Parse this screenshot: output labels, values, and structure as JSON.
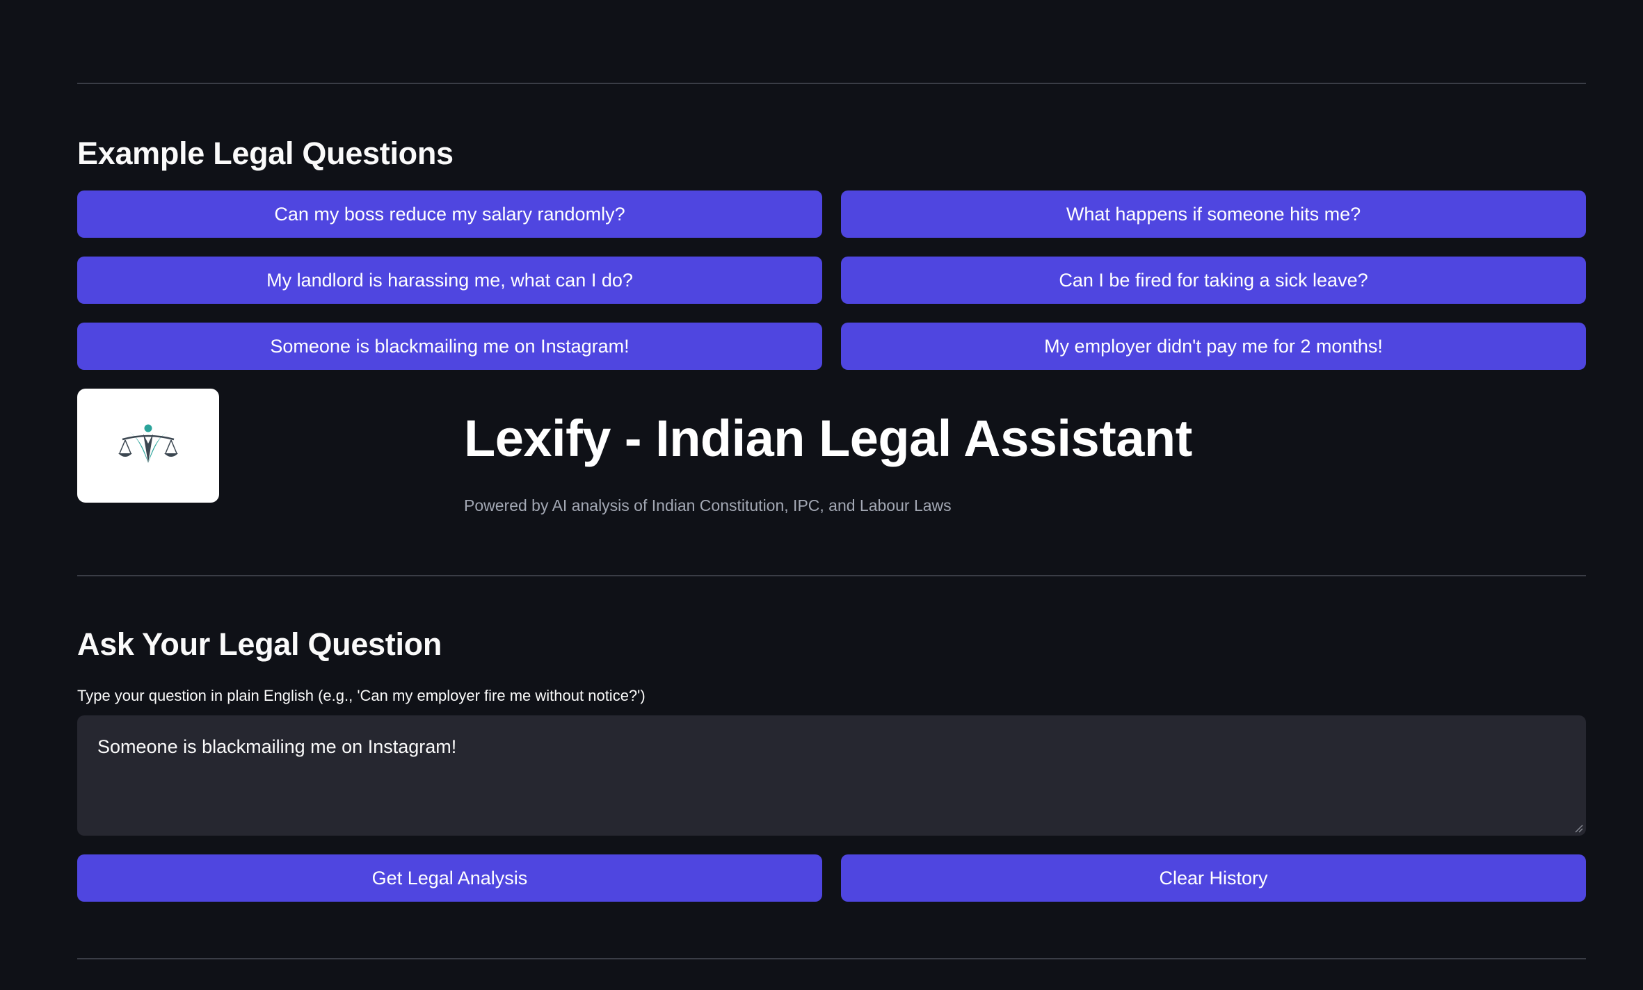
{
  "examples": {
    "heading": "Example Legal Questions",
    "questions": [
      "Can my boss reduce my salary randomly?",
      "What happens if someone hits me?",
      "My landlord is harassing me, what can I do?",
      "Can I be fired for taking a sick leave?",
      "Someone is blackmailing me on Instagram!",
      "My employer didn't pay me for 2 months!"
    ]
  },
  "header": {
    "logo_icon": "scales-of-justice-icon",
    "title": "Lexify - Indian Legal Assistant",
    "subtitle": "Powered by AI analysis of Indian Constitution, IPC, and Labour Laws"
  },
  "ask": {
    "heading": "Ask Your Legal Question",
    "label": "Type your question in plain English (e.g., 'Can my employer fire me without notice?')",
    "value": "Someone is blackmailing me on Instagram!",
    "primary_button": "Get Legal Analysis",
    "secondary_button": "Clear History"
  },
  "colors": {
    "background": "#0f1117",
    "accent": "#4f46e0",
    "input_bg": "#262730",
    "logo_teal": "#2aa39a",
    "logo_dark": "#3b4650"
  }
}
